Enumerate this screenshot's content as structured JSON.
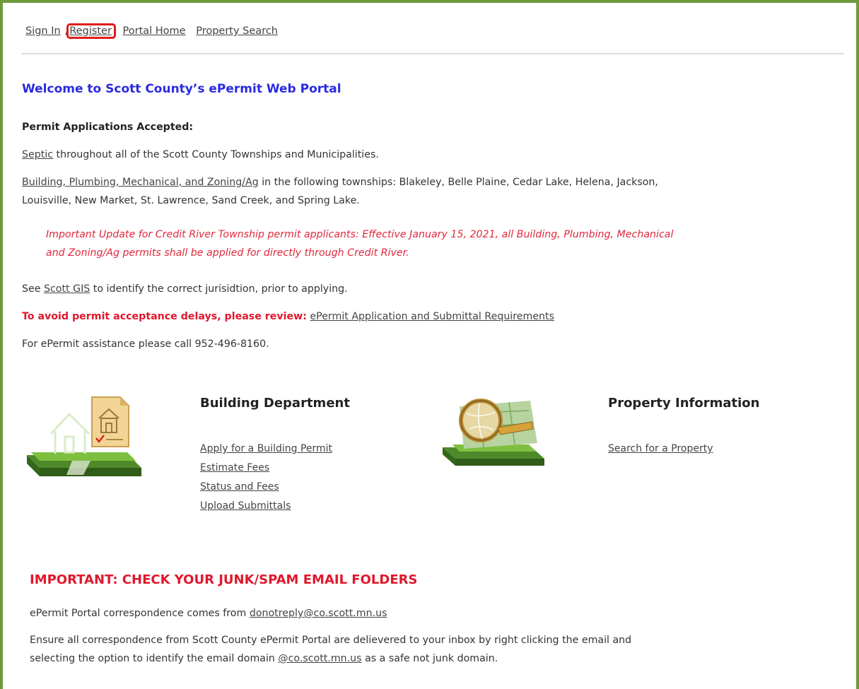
{
  "nav": {
    "sign_in": "Sign In",
    "separator": "/",
    "register": "Register",
    "portal_home": "Portal Home",
    "property_search": "Property Search"
  },
  "welcome": {
    "title": "Welcome to Scott County’s ePermit Web Portal",
    "accepted_heading": "Permit Applications Accepted:",
    "septic_link": "Septic",
    "septic_text": " throughout all of the Scott County Townships and Municipalities.",
    "building_link": "Building, Plumbing, Mechanical, and Zoning/Ag",
    "building_text": " in the following townships: Blakeley, Belle Plaine, Cedar Lake, Helena, Jackson,",
    "building_text2": "Louisville, New Market, St. Lawrence, Sand Creek, and Spring Lake.",
    "update_line1": "Important Update for Credit River Township permit applicants: Effective January 15, 2021, all Building, Plumbing, Mechanical",
    "update_line2": "and Zoning/Ag permits shall be applied for directly through Credit River.",
    "gis_prefix": "See ",
    "gis_link": "Scott GIS",
    "gis_suffix": " to identify the correct jurisidtion, prior to applying.",
    "review_label": "To avoid permit acceptance delays, please review:",
    "review_link": "ePermit Application and Submittal Requirements",
    "assistance": "For ePermit assistance please call 952-496-8160."
  },
  "building": {
    "icon": "house-permit-icon",
    "title": "Building Department",
    "links": [
      "Apply for a Building Permit",
      "Estimate Fees",
      "Status and Fees",
      "Upload Submittals"
    ]
  },
  "property": {
    "icon": "map-magnifier-icon",
    "title": "Property Information",
    "links": [
      "Search for a Property"
    ]
  },
  "spam": {
    "title": "IMPORTANT: CHECK YOUR JUNK/SPAM EMAIL FOLDERS",
    "from_text": "ePermit Portal correspondence comes from ",
    "from_email": "donotreply@co.scott.mn.us",
    "ensure_line1": "Ensure all correspondence from Scott County ePermit Portal are delievered to your inbox by right clicking the email and",
    "ensure_prefix": "selecting the option to identify the email domain ",
    "ensure_domain": "@co.scott.mn.us",
    "ensure_suffix": " as a safe not junk domain."
  },
  "colors": {
    "frame": "#6e9a3c",
    "welcome": "#2a2ae0",
    "alert_red": "#e0182c",
    "highlight_box": "#e01b1b"
  }
}
